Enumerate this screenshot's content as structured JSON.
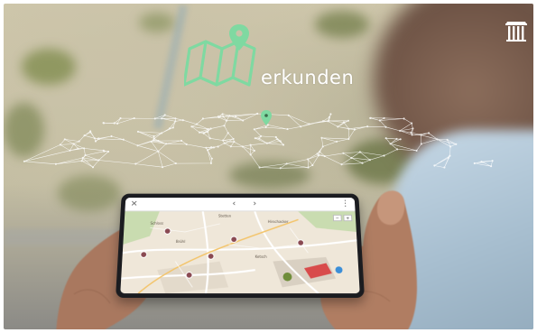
{
  "scene": {
    "overlay_word": "erkunden",
    "accent_color": "#7fd9a1",
    "mesh_color": "#ffffff",
    "icons": [
      "map-pin-icon",
      "folded-map-icon",
      "temple-logo-icon",
      "location-pin-icon"
    ]
  },
  "phone": {
    "toolbar": {
      "close_label": "×",
      "back_label": "‹",
      "forward_label": "›",
      "menu_label": "⋮"
    },
    "map_labels": [
      "Schloss",
      "Stetten",
      "Hirschacker",
      "Brühl",
      "Ketsch"
    ],
    "colors": {
      "poi": "#8a4a52",
      "road": "#ffffff",
      "land": "#efe7d9",
      "forest": "#c9dcb0"
    }
  }
}
